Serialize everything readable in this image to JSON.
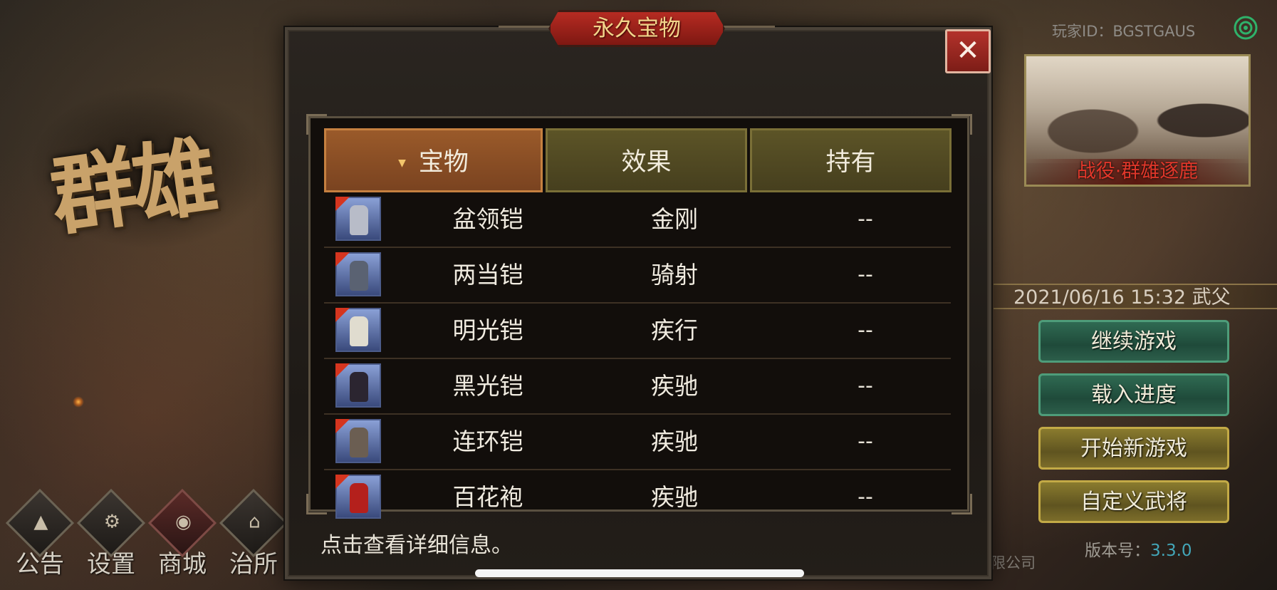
{
  "background": {
    "logo_text": "群雄",
    "player_id_label": "玩家ID：BGSTGAUS",
    "banner_caption": "战役·群雄逐鹿",
    "date_line": "2021/06/16 15:32 武父",
    "menu": [
      "继续游戏",
      "载入进度",
      "开始新游戏",
      "自定义武将"
    ],
    "version_label": "版本号：",
    "version_value": "3.3.0",
    "company_text": "有限公司",
    "bottom_nav": [
      {
        "label": "公告",
        "icon": "notice-icon"
      },
      {
        "label": "设置",
        "icon": "gear-icon"
      },
      {
        "label": "商城",
        "icon": "shop-icon"
      },
      {
        "label": "治所",
        "icon": "city-icon"
      }
    ]
  },
  "dialog": {
    "title": "永久宝物",
    "close_symbol": "✕",
    "columns": {
      "treasure": "宝物",
      "effect": "效果",
      "owned": "持有"
    },
    "sort_indicator": "▼",
    "rows": [
      {
        "name": "盆领铠",
        "effect": "金刚",
        "owned": "--",
        "thumb_color": "#b8bcc8"
      },
      {
        "name": "两当铠",
        "effect": "骑射",
        "owned": "--",
        "thumb_color": "#5a6272"
      },
      {
        "name": "明光铠",
        "effect": "疾行",
        "owned": "--",
        "thumb_color": "#e0dccf"
      },
      {
        "name": "黑光铠",
        "effect": "疾驰",
        "owned": "--",
        "thumb_color": "#2b2530"
      },
      {
        "name": "连环铠",
        "effect": "疾驰",
        "owned": "--",
        "thumb_color": "#6b5e52"
      },
      {
        "name": "百花袍",
        "effect": "疾驰",
        "owned": "--",
        "thumb_color": "#b4201c"
      }
    ],
    "hint": "点击查看详细信息。"
  }
}
